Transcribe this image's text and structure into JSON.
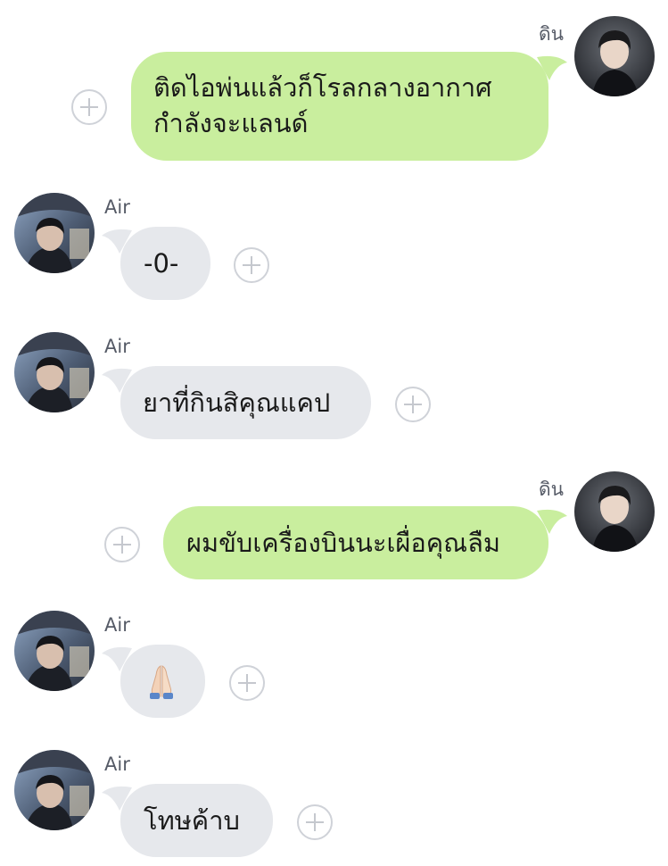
{
  "colors": {
    "outgoing_bubble": "#c9ee9e",
    "incoming_bubble": "#e6e8ec",
    "add_button_border": "#cfd2d8",
    "name_text": "#555a66"
  },
  "messages": [
    {
      "direction": "outgoing",
      "sender": "ดิน",
      "lines": [
        "ติดไอพ่นแล้วก็โรลกลางอากาศ",
        "กำลังจะแลนด์"
      ]
    },
    {
      "direction": "incoming",
      "sender": "Air",
      "text": "-0-"
    },
    {
      "direction": "incoming",
      "sender": "Air",
      "text": "ยาที่กินสิคุณแคป"
    },
    {
      "direction": "outgoing",
      "sender": "ดิน",
      "text": "ผมขับเครื่องบินนะเผื่อคุณลืม"
    },
    {
      "direction": "incoming",
      "sender": "Air",
      "text": "🙏🏻",
      "icon": "folded-hands-emoji"
    },
    {
      "direction": "incoming",
      "sender": "Air",
      "text": "โทษค้าบ"
    }
  ],
  "icons": {
    "add": "plus-circle-icon",
    "avatar_outgoing": "user-avatar-din",
    "avatar_incoming": "user-avatar-air"
  }
}
